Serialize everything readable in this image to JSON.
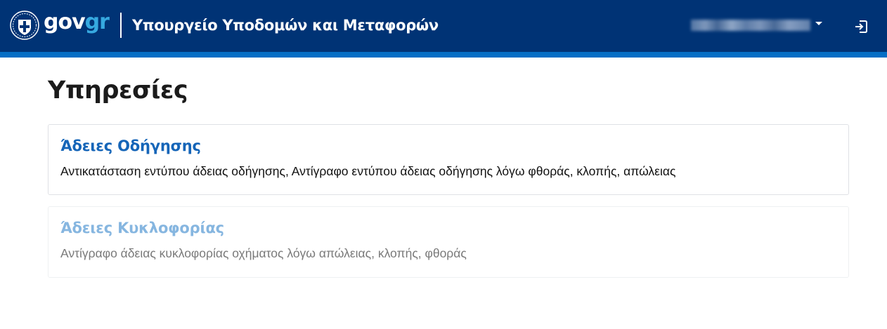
{
  "header": {
    "logo_prefix": "gov",
    "logo_suffix": "gr",
    "ministry": "Υπουργείο Υποδομών και Μεταφορών",
    "emblem_icon": "hellenic-republic-emblem-icon",
    "user_menu_icon": "caret-down-icon",
    "logout_icon": "logout-icon",
    "colors": {
      "bar": "#003375",
      "stripe": "#046ec5",
      "logo_accent": "#36a9e0"
    }
  },
  "main": {
    "title": "Υπηρεσίες",
    "services": [
      {
        "title": "Άδειες Οδήγησης",
        "description": "Αντικατάσταση εντύπου άδειας οδήγησης, Αντίγραφο εντύπου άδειας οδήγησης λόγω φθοράς, κλοπής, απώλειας"
      },
      {
        "title": "Άδειες Κυκλοφορίας",
        "description": "Αντίγραφο άδειας κυκλοφορίας οχήματος λόγω απώλειας, κλοπής, φθοράς"
      }
    ],
    "colors": {
      "link": "#1565b8",
      "link_muted": "#86b6e0"
    }
  }
}
